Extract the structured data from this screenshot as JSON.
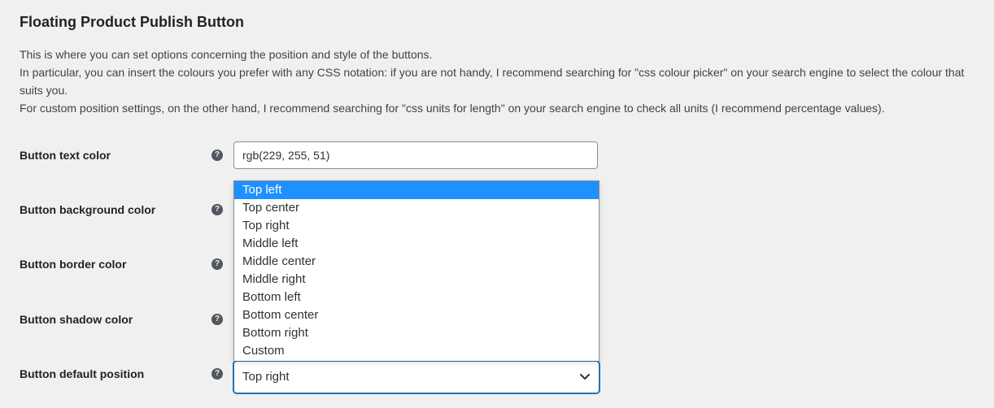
{
  "page": {
    "title": "Floating Product Publish Button",
    "intro": [
      "This is where you can set options concerning the position and style of the buttons.",
      "In particular, you can insert the colours you prefer with any CSS notation: if you are not handy, I recommend searching for \"css colour picker\" on your search engine to select the colour that suits you.",
      "For custom position settings, on the other hand, I recommend searching for \"css units for length\" on your search engine to check all units (I recommend percentage values)."
    ]
  },
  "fields": {
    "text_color": {
      "label": "Button text color",
      "value": "rgb(229, 255, 51)"
    },
    "background_color": {
      "label": "Button background color"
    },
    "border_color": {
      "label": "Button border color"
    },
    "shadow_color": {
      "label": "Button shadow color"
    },
    "default_position": {
      "label": "Button default position",
      "value": "Top right",
      "options": [
        "Top left",
        "Top center",
        "Top right",
        "Middle left",
        "Middle center",
        "Middle right",
        "Bottom left",
        "Bottom center",
        "Bottom right",
        "Custom"
      ],
      "highlighted_option": "Top left"
    }
  },
  "icons": {
    "help": "help-icon",
    "dropdown": "chevron-down-icon"
  },
  "colors": {
    "highlight": "#1e90ff",
    "focus_border": "#2271b1",
    "background": "#f0f0f1"
  }
}
